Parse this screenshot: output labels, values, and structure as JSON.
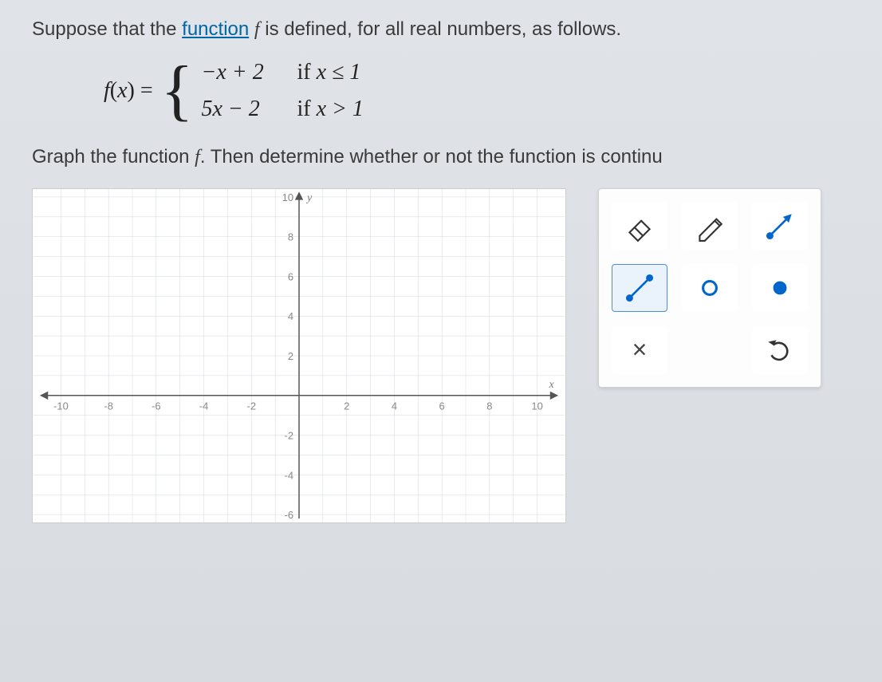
{
  "question": {
    "prefix": "Suppose that the ",
    "link_text": "function",
    "suffix_1": " ",
    "func_letter": "f",
    "suffix_2": " is defined, for all real numbers, as follows."
  },
  "equation": {
    "lhs_f": "f",
    "lhs_paren_open": "(",
    "lhs_x": "x",
    "lhs_paren_close": ")",
    "eq": " = ",
    "case1_expr": "−x + 2",
    "case1_if": "if ",
    "case1_cond": "x ≤ 1",
    "case2_expr": "5x − 2",
    "case2_if": "if ",
    "case2_cond": "x > 1"
  },
  "instruction": {
    "prefix": "Graph the function ",
    "func_letter": "f",
    "suffix": ". Then determine whether or not the function is continu"
  },
  "graph": {
    "x_label": "x",
    "y_label": "y",
    "x_ticks": [
      "-10",
      "-8",
      "-6",
      "-4",
      "-2",
      "2",
      "4",
      "6",
      "8",
      "10"
    ],
    "y_ticks": [
      "10",
      "8",
      "6",
      "4",
      "2",
      "-2",
      "-4",
      "-6"
    ],
    "x_range": [
      -11,
      11
    ],
    "y_range": [
      -7,
      11
    ]
  },
  "tools": {
    "eraser": "eraser-icon",
    "pencil": "pencil-icon",
    "ray": "ray-icon",
    "line": "line-icon",
    "open_circle": "open-circle-icon",
    "closed_circle": "closed-circle-icon",
    "clear": "×",
    "undo": "undo-icon"
  },
  "chart_data": {
    "type": "line",
    "title": "",
    "xlabel": "x",
    "ylabel": "y",
    "xlim": [
      -11,
      11
    ],
    "ylim": [
      -7,
      11
    ],
    "grid": true,
    "series": []
  }
}
